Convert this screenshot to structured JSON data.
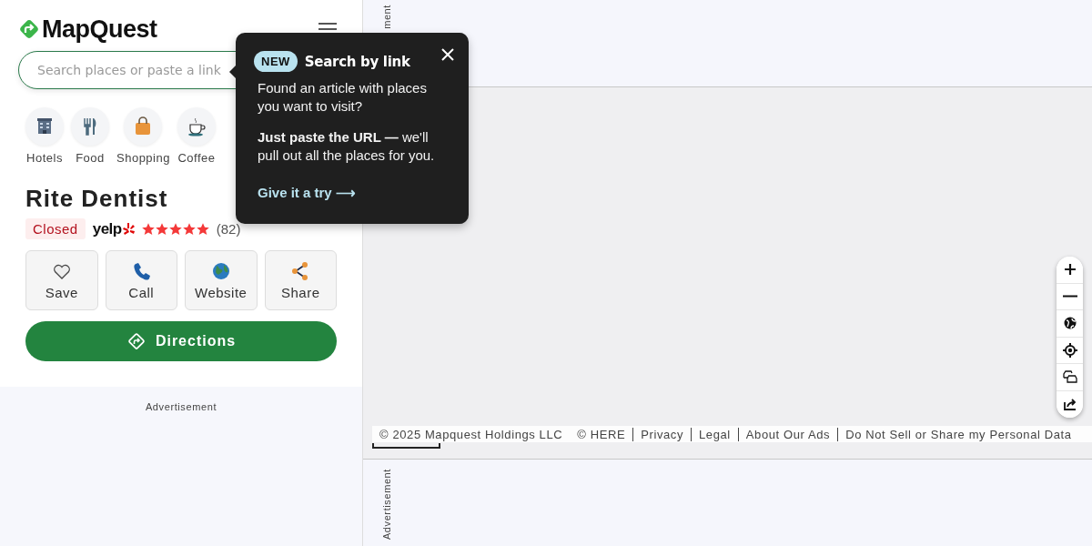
{
  "header": {
    "logo": "MapQuest"
  },
  "search": {
    "placeholder": "Search places or paste a link"
  },
  "categories": [
    {
      "label": "Hotels",
      "kind": "hotel"
    },
    {
      "label": "Food",
      "kind": "food"
    },
    {
      "label": "Shopping",
      "kind": "shopping"
    },
    {
      "label": "Coffee",
      "kind": "coffee"
    }
  ],
  "place": {
    "name": "Rite Dentist",
    "status": "Closed",
    "rating_source": "yelp",
    "stars": 5,
    "review_count": "(82)"
  },
  "actions": [
    {
      "label": "Save",
      "kind": "save"
    },
    {
      "label": "Call",
      "kind": "call"
    },
    {
      "label": "Website",
      "kind": "website"
    },
    {
      "label": "Share",
      "kind": "share"
    }
  ],
  "directions_button": "Directions",
  "sidebar_ad": "Advertisement",
  "top_ad": "ment",
  "bottom_ad": "Advertisement",
  "map": {
    "controls": [
      {
        "kind": "zoom_in"
      },
      {
        "kind": "zoom_out"
      },
      {
        "kind": "globe"
      },
      {
        "kind": "locate"
      },
      {
        "kind": "traffic"
      },
      {
        "kind": "share"
      }
    ],
    "footer": [
      {
        "text": "© 2025 Mapquest Holdings LLC",
        "kind": "copyright"
      },
      {
        "text": "© HERE",
        "kind": "copyright"
      },
      {
        "text": "Privacy",
        "kind": "link"
      },
      {
        "text": "Legal",
        "kind": "link"
      },
      {
        "text": "About Our Ads",
        "kind": "link"
      },
      {
        "text": "Do Not Sell or Share my Personal Data",
        "kind": "link"
      }
    ]
  },
  "popover": {
    "badge": "NEW",
    "title": "Search by link",
    "body": "Found an article with places you want to visit?",
    "tip": "**Just paste the URL —** we'll pull out all the places for you.",
    "link": "Give it a try ⟶"
  }
}
